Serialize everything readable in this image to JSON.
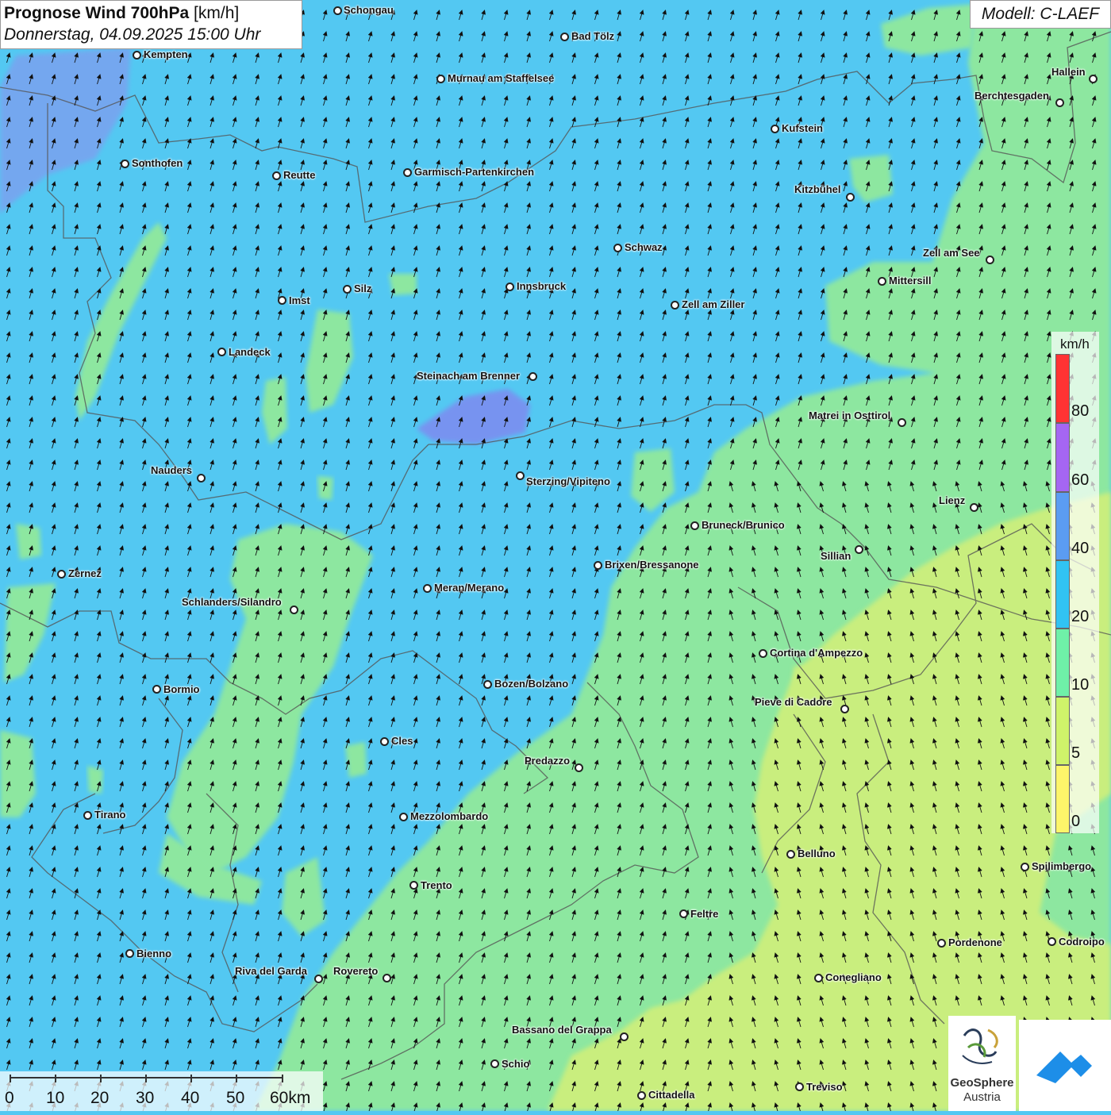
{
  "title": {
    "main": "Prognose Wind 700hPa",
    "unit": "[km/h]",
    "date": "Donnerstag, 04.09.2025 15:00 Uhr"
  },
  "model": "Modell: C-LAEF",
  "legend": {
    "unit": "km/h",
    "labels": [
      "80",
      "60",
      "40",
      "20",
      "10",
      "5",
      "0"
    ],
    "colors": [
      "#ff3333",
      "#a566f2",
      "#5b9cf2",
      "#31c3f3",
      "#6ff0a8",
      "#cff36a",
      "#fdf56a"
    ]
  },
  "scale": {
    "labels": [
      "0",
      "10",
      "20",
      "30",
      "40",
      "50",
      "60km"
    ]
  },
  "logos": {
    "geosphere_name": "GeoSphere",
    "geosphere_sub": "Austria"
  },
  "cities": [
    {
      "name": "Schongau"
    },
    {
      "name": "Bad Tölz"
    },
    {
      "name": "Kempten"
    },
    {
      "name": "Murnau am Staffelsee"
    },
    {
      "name": "Hallein"
    },
    {
      "name": "Berchtesgaden"
    },
    {
      "name": "Kufstein"
    },
    {
      "name": "Sonthofen"
    },
    {
      "name": "Reutte"
    },
    {
      "name": "Garmisch-Partenkirchen"
    },
    {
      "name": "Kitzbühel"
    },
    {
      "name": "Schwaz"
    },
    {
      "name": "Zell am See"
    },
    {
      "name": "Mittersill"
    },
    {
      "name": "Innsbruck"
    },
    {
      "name": "Silz"
    },
    {
      "name": "Imst"
    },
    {
      "name": "Zell am Ziller"
    },
    {
      "name": "Landeck"
    },
    {
      "name": "Steinach am Brenner"
    },
    {
      "name": "Matrei in Osttirol"
    },
    {
      "name": "Nauders"
    },
    {
      "name": "Sterzing/Vipiteno"
    },
    {
      "name": "Lienz"
    },
    {
      "name": "Bruneck/Brunico"
    },
    {
      "name": "Sillian"
    },
    {
      "name": "Zernez"
    },
    {
      "name": "Brixen/Bressanone"
    },
    {
      "name": "Meran/Merano"
    },
    {
      "name": "Schlanders/Silandro"
    },
    {
      "name": "Cortina d'Ampezzo"
    },
    {
      "name": "Bormio"
    },
    {
      "name": "Bozen/Bolzano"
    },
    {
      "name": "Pieve di Cadore"
    },
    {
      "name": "Cles"
    },
    {
      "name": "Predazzo"
    },
    {
      "name": "Tirano"
    },
    {
      "name": "Mezzolombardo"
    },
    {
      "name": "Belluno"
    },
    {
      "name": "Spilimbergo"
    },
    {
      "name": "Trento"
    },
    {
      "name": "Feltre"
    },
    {
      "name": "Pordenone"
    },
    {
      "name": "Codroipo"
    },
    {
      "name": "Bienno"
    },
    {
      "name": "Riva del Garda"
    },
    {
      "name": "Rovereto"
    },
    {
      "name": "Conegliano"
    },
    {
      "name": "Bassano del Grappa"
    },
    {
      "name": "Schio"
    },
    {
      "name": "Treviso"
    },
    {
      "name": "Cittadella"
    }
  ]
}
